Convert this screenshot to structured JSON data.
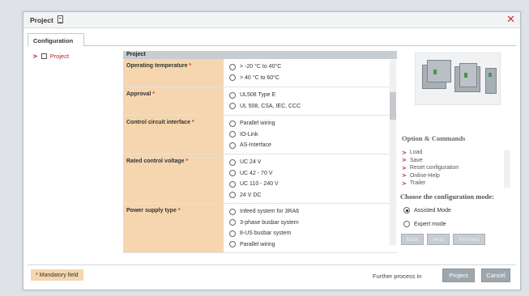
{
  "window": {
    "title": "Project",
    "close_glyph": "✕"
  },
  "tabs": [
    {
      "label": "Configuration"
    }
  ],
  "tree": {
    "arrow": ">",
    "item_label": "Project"
  },
  "form": {
    "header": "Project",
    "required_mark": "*",
    "rows": [
      {
        "label": "Operating temperature",
        "options": [
          "> -20 °C to 40°C",
          "> 40 °C to 60°C"
        ]
      },
      {
        "label": "Approval",
        "options": [
          "UL508 Type E",
          "UL 508, CSA, IEC, CCC"
        ]
      },
      {
        "label": "Control circuit interface",
        "options": [
          "Parallel wiring",
          "IO-Link",
          "AS-Interface"
        ]
      },
      {
        "label": "Rated control voltage",
        "options": [
          "UC 24 V",
          "UC 42 - 70 V",
          "UC 110 - 240 V",
          "24 V DC"
        ]
      },
      {
        "label": "Power supply type",
        "options": [
          "Infeed system for 3RA6",
          "3-phase busbar system",
          "8-US busbar system",
          "Parallel wiring"
        ]
      }
    ]
  },
  "commands": {
    "title": "Option & Commands",
    "arrow": ">",
    "items": [
      "Load",
      "Save",
      "Reset configuration",
      "Online-Help",
      "Trailer"
    ]
  },
  "mode": {
    "title": "Choose the configuration mode:",
    "options": [
      {
        "label": "Assisted Mode",
        "selected": true
      },
      {
        "label": "Expert mode",
        "selected": false
      }
    ]
  },
  "nav_buttons": {
    "back": "Back",
    "next": "Next",
    "finished": "Finished"
  },
  "footer": {
    "mandatory_label": "* Mandatory field",
    "further_label": "Further process in",
    "project_button": "Project",
    "cancel_button": "Cancel"
  },
  "colors": {
    "accent_red": "#b2222b",
    "required_bg": "#f5d6ae",
    "button_gray": "#9fa7ae"
  },
  "icons": {
    "title_icon": "document-icon",
    "close": "close-icon",
    "tree_arrow": "chevron-right-icon"
  }
}
